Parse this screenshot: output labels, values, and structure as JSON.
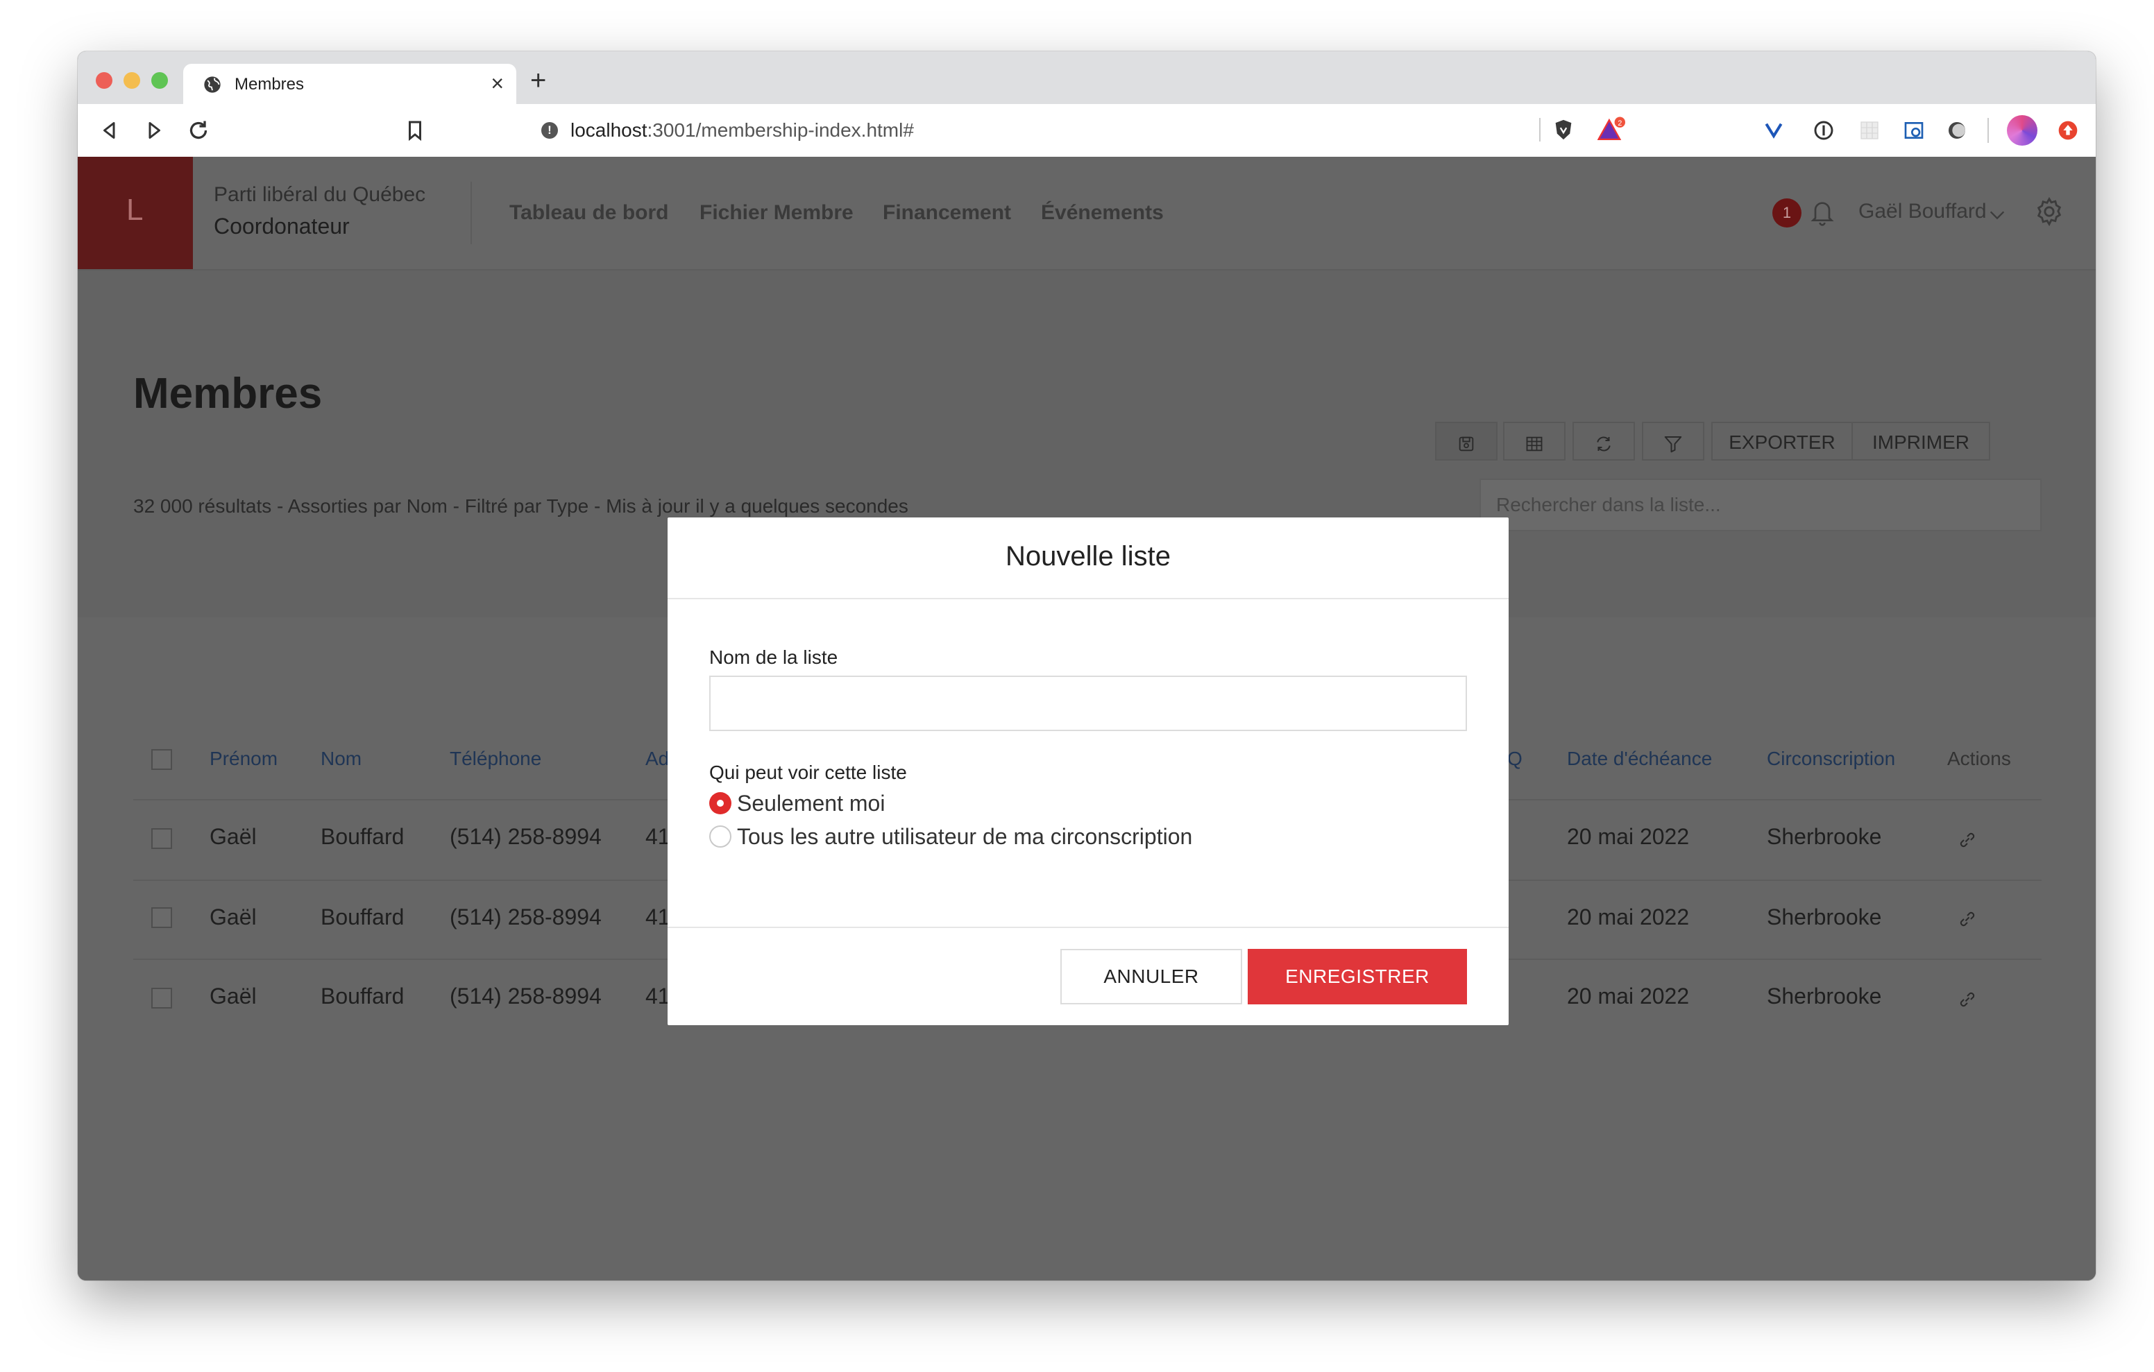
{
  "browser": {
    "tab_title": "Membres",
    "url_host": "localhost",
    "url_path": ":3001/membership-index.html#",
    "extension_badge": "2"
  },
  "header": {
    "brand_letter": "L",
    "org_name": "Parti libéral du Québec",
    "role": "Coordonateur",
    "nav": [
      "Tableau de bord",
      "Fichier Membre",
      "Financement",
      "Événements"
    ],
    "notification_count": "1",
    "user_name": "Gaël Bouffard"
  },
  "page": {
    "title": "Membres",
    "subtitle": "32 000 résultats - Assorties par Nom - Filtré par Type - Mis à jour il y a quelques secondes",
    "export_label": "EXPORTER",
    "print_label": "IMPRIMER",
    "search_placeholder": "Rechercher dans la liste..."
  },
  "table": {
    "columns": {
      "first_name": "Prénom",
      "last_name": "Nom",
      "phone": "Téléphone",
      "address_partial": "Ad",
      "col_partial": "Q",
      "due_date": "Date d'échéance",
      "riding": "Circonscription",
      "actions": "Actions"
    },
    "rows": [
      {
        "first_name": "Gaël",
        "last_name": "Bouffard",
        "phone": "(514) 258-8994",
        "address_partial": "41",
        "due_date": "20 mai 2022",
        "riding": "Sherbrooke"
      },
      {
        "first_name": "Gaël",
        "last_name": "Bouffard",
        "phone": "(514) 258-8994",
        "address_partial": "41",
        "due_date": "20 mai 2022",
        "riding": "Sherbrooke"
      },
      {
        "first_name": "Gaël",
        "last_name": "Bouffard",
        "phone": "(514) 258-8994",
        "address_partial": "41",
        "due_date": "20 mai 2022",
        "riding": "Sherbrooke"
      }
    ]
  },
  "modal": {
    "title": "Nouvelle liste",
    "name_label": "Nom de la liste",
    "name_value": "",
    "visibility_label": "Qui peut voir cette liste",
    "options": [
      {
        "label": "Seulement moi",
        "selected": true
      },
      {
        "label": "Tous les autre utilisateur de ma circonscription",
        "selected": false
      }
    ],
    "cancel_label": "ANNULER",
    "save_label": "ENREGISTRER"
  },
  "colors": {
    "accent_red": "#e0363a",
    "overlay": "#666666",
    "link_blue": "#1f3555"
  }
}
